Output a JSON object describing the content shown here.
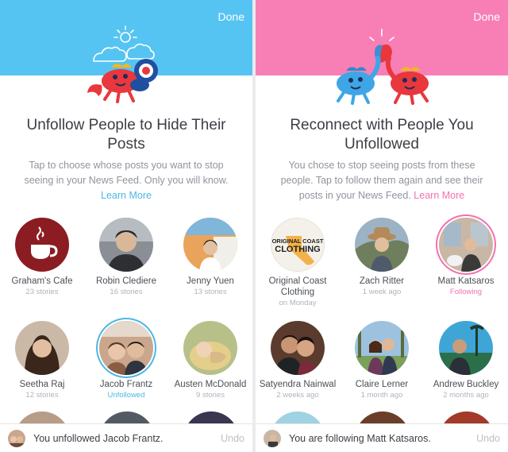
{
  "left": {
    "done_label": "Done",
    "title": "Unfollow People to Hide Their Posts",
    "description": "Tap to choose whose posts you want to stop seeing in your News Feed. Only you will know.",
    "learn_more": "Learn More",
    "people": [
      {
        "name": "Graham's Cafe",
        "sub": "23 stories"
      },
      {
        "name": "Robin Clediere",
        "sub": "16 stories"
      },
      {
        "name": "Jenny Yuen",
        "sub": "13 stories"
      },
      {
        "name": "Seetha Raj",
        "sub": "12 stories"
      },
      {
        "name": "Jacob Frantz",
        "sub": "Unfollowed"
      },
      {
        "name": "Austen McDonald",
        "sub": "9 stories"
      }
    ],
    "toast": {
      "text": "You unfollowed Jacob Frantz.",
      "undo": "Undo"
    }
  },
  "right": {
    "done_label": "Done",
    "title": "Reconnect with People You Unfollowed",
    "description": "You chose to stop seeing posts from these people. Tap to follow them again and see their posts in your News Feed.",
    "learn_more": "Learn More",
    "people": [
      {
        "name": "Original Coast Clothing",
        "sub": "on Monday",
        "logo_line1": "ORIGINAL COAST",
        "logo_line2": "CLOTHING"
      },
      {
        "name": "Zach Ritter",
        "sub": "1 week ago"
      },
      {
        "name": "Matt Katsaros",
        "sub": "Following"
      },
      {
        "name": "Satyendra Nainwal",
        "sub": "2 weeks ago"
      },
      {
        "name": "Claire Lerner",
        "sub": "1 month ago"
      },
      {
        "name": "Andrew Buckley",
        "sub": "2 months ago"
      }
    ],
    "toast": {
      "text": "You are following Matt Katsaros.",
      "undo": "Undo"
    }
  },
  "colors": {
    "left_header": "#55c4f2",
    "right_header": "#f77fb6",
    "accent_blue": "#4cb7e6",
    "accent_pink": "#f470ae"
  }
}
